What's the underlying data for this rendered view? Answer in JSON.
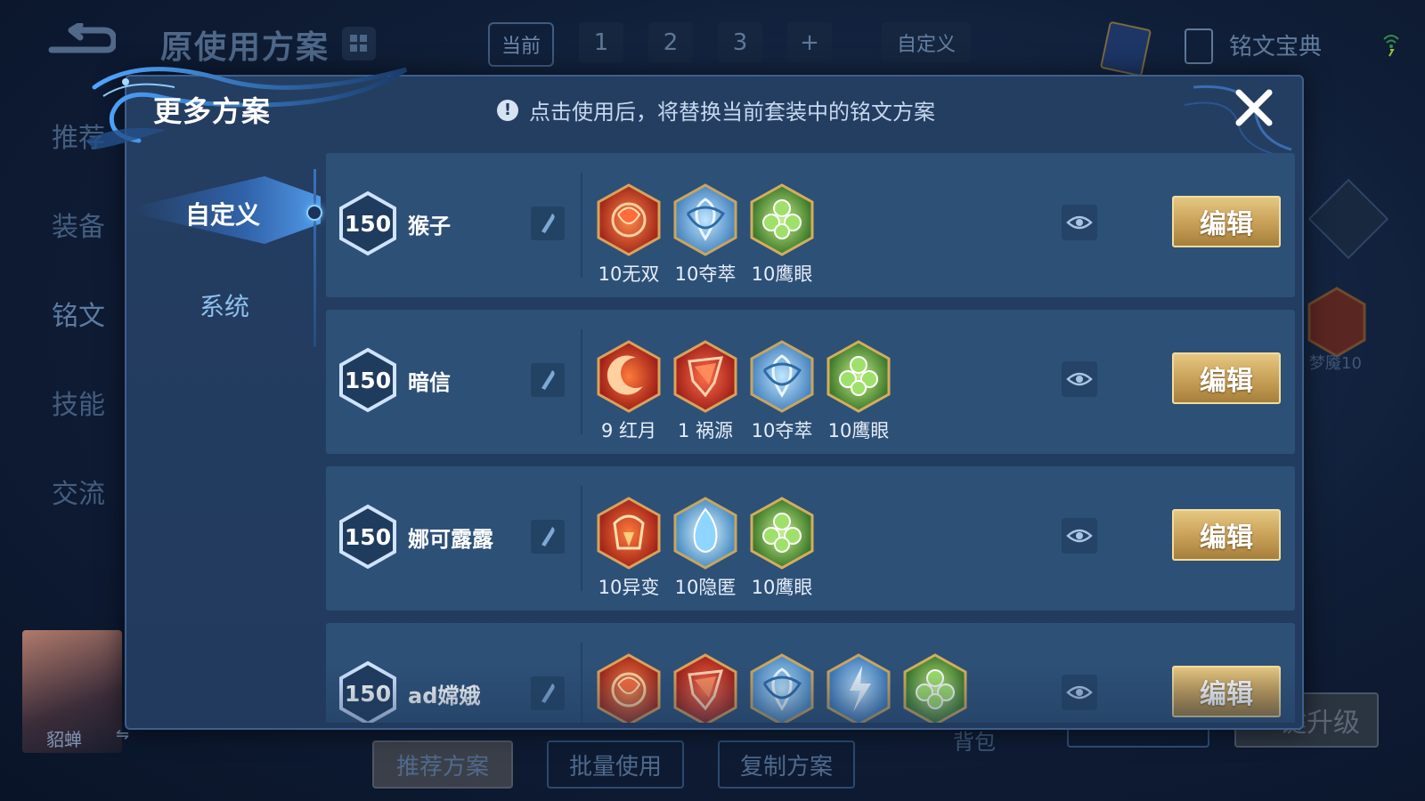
{
  "background": {
    "title": "原使用方案",
    "tabs": {
      "current": "当前",
      "numbers": [
        "1",
        "2",
        "3",
        "+"
      ],
      "custom": "自定义"
    },
    "book_label": "铭文宝典",
    "left_nav": [
      "推荐",
      "装备",
      "铭文",
      "技能",
      "交流"
    ],
    "hero_name": "貂蝉",
    "bottom_buttons": [
      "推荐方案",
      "批量使用",
      "复制方案"
    ],
    "bag_label": "背包",
    "upgrade_label": "一键升级",
    "side_rune_label": "梦魇10"
  },
  "modal": {
    "title": "更多方案",
    "notice": "点击使用后，将替换当前套装中的铭文方案",
    "sidebar": [
      {
        "label": "自定义",
        "active": true
      },
      {
        "label": "系统",
        "active": false
      }
    ],
    "edit_label": "编辑",
    "plans": [
      {
        "level": "150",
        "name": "猴子",
        "runes": [
          {
            "label": "10无双",
            "gem": "red-rose"
          },
          {
            "label": "10夺萃",
            "gem": "blue-knot"
          },
          {
            "label": "10鹰眼",
            "gem": "green-clover"
          }
        ]
      },
      {
        "level": "150",
        "name": "暗信",
        "runes": [
          {
            "label": "9 红月",
            "gem": "red-moon"
          },
          {
            "label": "1 祸源",
            "gem": "red-shard"
          },
          {
            "label": "10夺萃",
            "gem": "blue-knot"
          },
          {
            "label": "10鹰眼",
            "gem": "green-clover"
          }
        ]
      },
      {
        "level": "150",
        "name": "娜可露露",
        "runes": [
          {
            "label": "10异变",
            "gem": "red-tower"
          },
          {
            "label": "10隐匿",
            "gem": "blue-flame"
          },
          {
            "label": "10鹰眼",
            "gem": "green-clover"
          }
        ]
      },
      {
        "level": "150",
        "name": "ad嫦娥",
        "runes": [
          {
            "label": "",
            "gem": "red-rose"
          },
          {
            "label": "",
            "gem": "red-shard"
          },
          {
            "label": "",
            "gem": "blue-knot"
          },
          {
            "label": "",
            "gem": "blue-bolt"
          },
          {
            "label": "",
            "gem": "green-clover"
          }
        ]
      }
    ]
  },
  "colors": {
    "accent_gold": "#caa25a",
    "panel": "#243e62",
    "row": "#2d5077",
    "highlight": "#6ab8ff"
  }
}
